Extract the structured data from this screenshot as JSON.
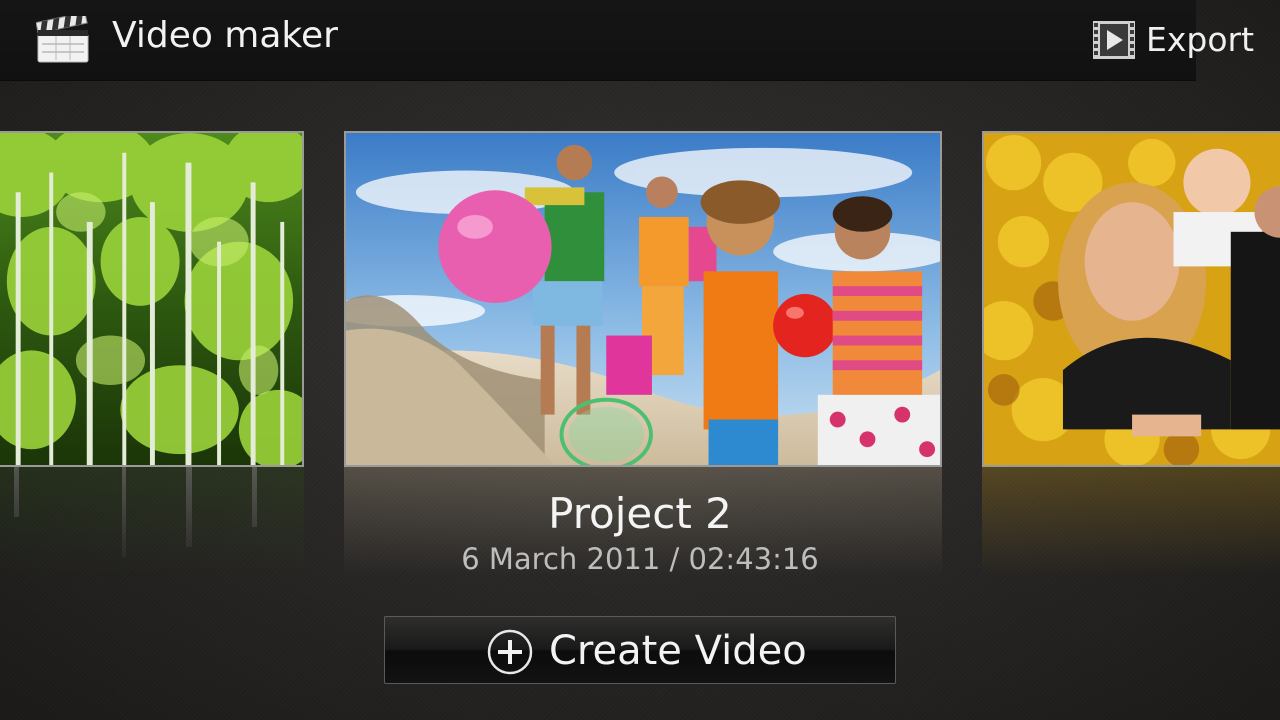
{
  "header": {
    "app_title": "Video maker",
    "app_icon": "clapperboard-icon",
    "export_label": "Export",
    "export_icon": "filmstrip-play-icon"
  },
  "carousel": {
    "items": [
      {
        "thumbnail": "forest-thumbnail"
      },
      {
        "thumbnail": "beach-family-thumbnail"
      },
      {
        "thumbnail": "autumn-family-thumbnail"
      }
    ],
    "selected_index": 1
  },
  "project": {
    "title": "Project 2",
    "date": "6 March 2011 / 02:43:16"
  },
  "create_button": {
    "label": "Create Video",
    "icon": "plus-circle-icon"
  },
  "colors": {
    "background": "#2a2827",
    "topbar": "#141313",
    "text_primary": "#f2f2f2",
    "text_secondary": "#bdbdbd",
    "card_border": "#9a9a98"
  }
}
